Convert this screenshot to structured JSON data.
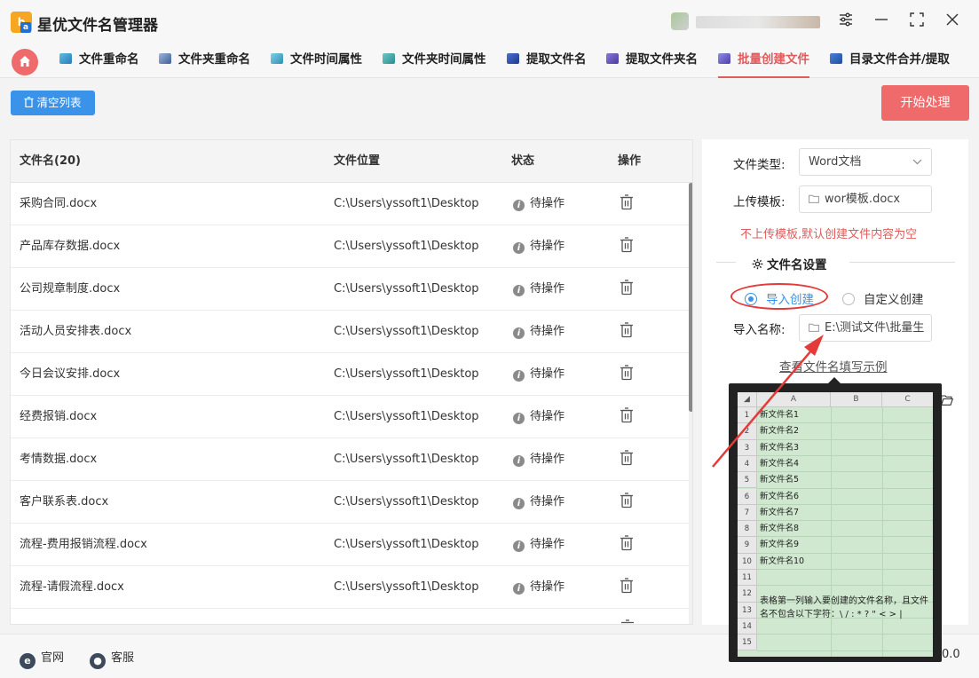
{
  "app": {
    "title": "星优文件名管理器"
  },
  "window_controls": [
    "settings-icon",
    "minimize-icon",
    "maximize-icon",
    "close-icon"
  ],
  "tabs": [
    {
      "label": "文件重命名",
      "active": false
    },
    {
      "label": "文件夹重命名",
      "active": false
    },
    {
      "label": "文件时间属性",
      "active": false
    },
    {
      "label": "文件夹时间属性",
      "active": false
    },
    {
      "label": "提取文件名",
      "active": false
    },
    {
      "label": "提取文件夹名",
      "active": false
    },
    {
      "label": "批量创建文件",
      "active": true
    },
    {
      "label": "目录文件合并/提取",
      "active": false
    }
  ],
  "toolbar": {
    "clear_label": "清空列表",
    "start_label": "开始处理"
  },
  "table": {
    "headers": {
      "name": "文件名(20)",
      "location": "文件位置",
      "status": "状态",
      "action": "操作"
    },
    "rows": [
      {
        "name": "采购合同.docx",
        "location": "C:\\Users\\yssoft1\\Desktop",
        "status": "待操作"
      },
      {
        "name": "产品库存数据.docx",
        "location": "C:\\Users\\yssoft1\\Desktop",
        "status": "待操作"
      },
      {
        "name": "公司规章制度.docx",
        "location": "C:\\Users\\yssoft1\\Desktop",
        "status": "待操作"
      },
      {
        "name": "活动人员安排表.docx",
        "location": "C:\\Users\\yssoft1\\Desktop",
        "status": "待操作"
      },
      {
        "name": "今日会议安排.docx",
        "location": "C:\\Users\\yssoft1\\Desktop",
        "status": "待操作"
      },
      {
        "name": "经费报销.docx",
        "location": "C:\\Users\\yssoft1\\Desktop",
        "status": "待操作"
      },
      {
        "name": "考情数据.docx",
        "location": "C:\\Users\\yssoft1\\Desktop",
        "status": "待操作"
      },
      {
        "name": "客户联系表.docx",
        "location": "C:\\Users\\yssoft1\\Desktop",
        "status": "待操作"
      },
      {
        "name": "流程-费用报销流程.docx",
        "location": "C:\\Users\\yssoft1\\Desktop",
        "status": "待操作"
      },
      {
        "name": "流程-请假流程.docx",
        "location": "C:\\Users\\yssoft1\\Desktop",
        "status": "待操作"
      }
    ]
  },
  "settings": {
    "file_type_label": "文件类型:",
    "file_type_value": "Word文档",
    "template_label": "上传模板:",
    "template_value": "wor模板.docx",
    "warning": "不上传模板,默认创建文件内容为空",
    "section_title": "文件名设置",
    "radio_import": "导入创建",
    "radio_custom": "自定义创建",
    "import_label": "导入名称:",
    "import_value": "E:\\测试文件\\批量生",
    "example_link": "查看文件名填写示例"
  },
  "popup": {
    "columns": [
      "A",
      "B",
      "C"
    ],
    "row_numbers": [
      "1",
      "2",
      "3",
      "4",
      "5",
      "6",
      "7",
      "8",
      "9",
      "10",
      "11",
      "12",
      "13",
      "14",
      "15"
    ],
    "cells": [
      "新文件名1",
      "新文件名2",
      "新文件名3",
      "新文件名4",
      "新文件名5",
      "新文件名6",
      "新文件名7",
      "新文件名8",
      "新文件名9",
      "新文件名10"
    ],
    "note": "表格第一列输入要创建的文件名称，且文件名不包含以下字符：\\ / : * ? \" < > |"
  },
  "statusbar": {
    "website": "官网",
    "support": "客服",
    "version": "0.0"
  },
  "colors": {
    "accent": "#3a93e8",
    "primary": "#ef6b6b",
    "warning": "#e05b5b"
  }
}
